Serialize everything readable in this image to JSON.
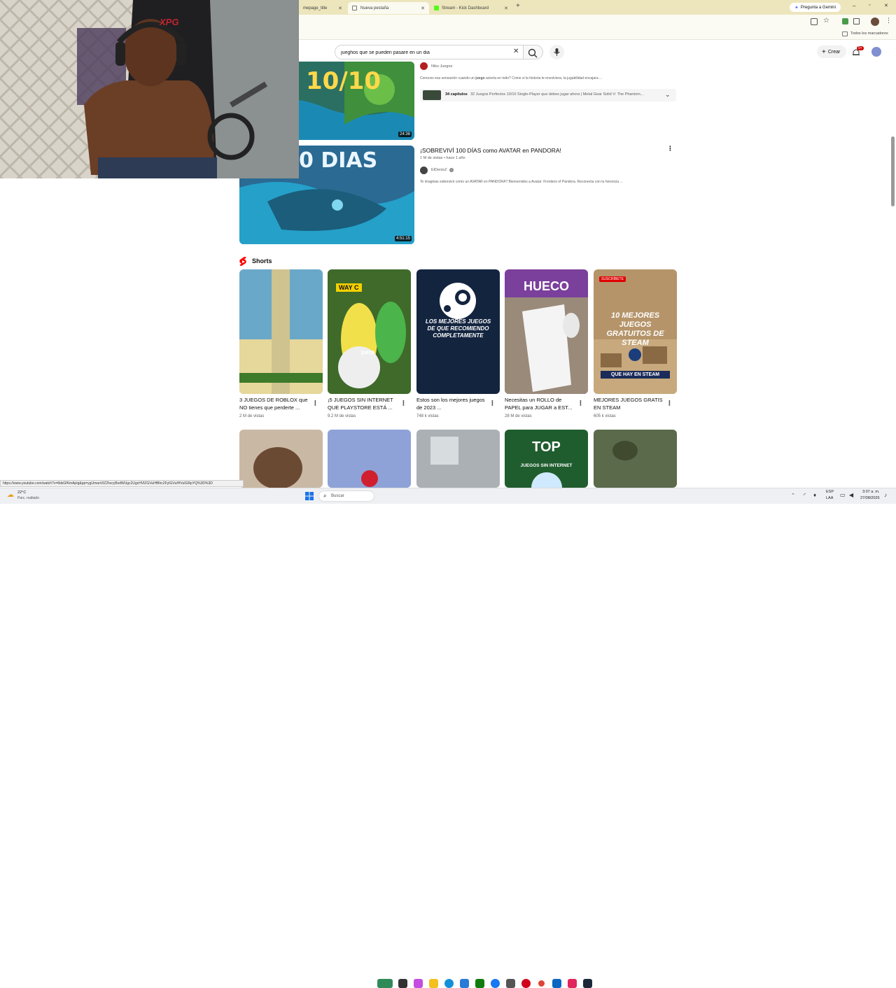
{
  "browser": {
    "tabs": [
      {
        "label": "mepage_title"
      },
      {
        "label": "Nueva pestaña"
      },
      {
        "label": "Stream - Kick Dashboard"
      }
    ],
    "gemini_label": "Pregunta a Gemini",
    "bookmarks_label": "Todos los marcadores",
    "status_url": "https://www.youtube.com/watch?v=8dsGfKmApIg&pp=ygUmanVlZ2hvcyBxdWUgc2UgcHVlZGVuIHBhc2FyIGVuIHVuIGRpYQ%3D%3D"
  },
  "youtube": {
    "search": {
      "value": "jueghos que se pueden pasare en un dia"
    },
    "create_label": "Crear",
    "notif_count": "9+",
    "videos": [
      {
        "thumb_text": "10/10",
        "duration": "24:38",
        "channel": "Niko Juegos",
        "desc_pre": "Conoces esa sensación cuando un ",
        "desc_bold": "juego",
        "desc_post": " acierta en todo? Como si la historia te envolviera, la jugabilidad encajara ...",
        "chapters_count": "34 capítulos",
        "chapters_text": "32 Juegos Perfectos 10/10 Single-Player que debes jugar ahora | Metal Gear Solid V: The Phantom..."
      },
      {
        "thumb_text": "0 DIAS",
        "duration": "4:51:15",
        "title": "¡SOBREVIVÍ 100 DÍAS como AVATAR en PANDORA!",
        "meta": "1 M de vistas • hace 1 año",
        "channel": "ElDenisZ",
        "desc": "Te imaginas sobrevivir como un AVATAR en PANDORA? Bienvenidos a Avatar: Frontiers of Pandora. Reconecta con tu herencia ..."
      }
    ],
    "shorts_heading": "Shorts",
    "shorts": [
      {
        "title": "3 JUEGOS DE ROBLOX que NO tienes que perderte ...",
        "views": "2 M de vistas",
        "bg": "#6aa8c9",
        "overlay": ""
      },
      {
        "title": "¡5 JUEGOS SIN INTERNET QUE PLAYSTORE ESTÁ ...",
        "views": "9.2 M de vistas",
        "bg": "#3f6a2a",
        "overlay": "WAY C",
        "overlay2": "para"
      },
      {
        "title": "Estos son los mejores juegos de 2023 ...",
        "views": "748 k vistas",
        "bg": "#13243f",
        "overlay": "LOS MEJORES JUEGOS DE QUE RECOMIENDO COMPLETAMENTE"
      },
      {
        "title": "Necesitas un ROLLO de PAPEL para JUGAR a EST...",
        "views": "28 M de vistas",
        "bg": "#7b3f9c",
        "overlay": "HUECO"
      },
      {
        "title": "MEJORES JUEGOS GRATIS EN STEAM",
        "views": "605 k vistas",
        "bg": "#b59469",
        "overlay": "10 MEJORES JUEGOS GRATUITOS DE STEAM",
        "overlay2": "QUE HAY EN STEAM",
        "badge": "SUSCRÍBETE"
      }
    ],
    "shorts_row2": [
      {
        "bg": "#c9b8a4"
      },
      {
        "bg": "#8ea2d8"
      },
      {
        "bg": "#aab0b4"
      },
      {
        "bg": "#1f5d2e",
        "overlay": "TOP",
        "overlay2": "JUEGOS SIN INTERNET"
      },
      {
        "bg": "#5a6a4a"
      }
    ]
  },
  "webcam": {
    "chair_brand": "XPG"
  },
  "taskbar": {
    "weather_temp": "22°C",
    "weather_desc": "Parc. nublado",
    "search_label": "Buscar",
    "lang_top": "ESP",
    "lang_bottom": "LAA",
    "time": "3:07 a. m.",
    "date": "27/08/2026"
  },
  "colors": {
    "accent_red": "#ff0000",
    "chrome_yellow": "#ede6bd"
  }
}
